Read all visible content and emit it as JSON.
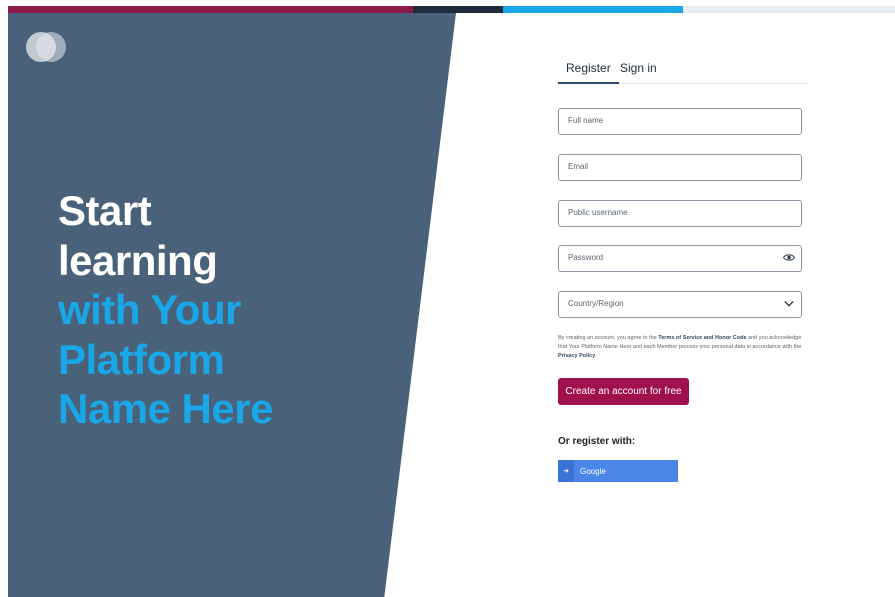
{
  "colors": {
    "panel": "#4a6279",
    "accent_blue": "#1aa7e8",
    "brand_magenta": "#a0104e",
    "tab_underline": "#2e4a66",
    "google_blue": "#4a86e8",
    "topbar_segments": [
      "#8b1a4a",
      "#8b1a4a",
      "#1c2c3a",
      "#1aa7e8",
      "#e6edf2"
    ]
  },
  "hero": {
    "line1": "Start",
    "line2": "learning",
    "line3": "with Your",
    "line4": "Platform",
    "line5": "Name Here"
  },
  "tabs": {
    "register": "Register",
    "signin": "Sign in"
  },
  "form": {
    "fullname_placeholder": "Full name",
    "email_placeholder": "Email",
    "username_placeholder": "Public username",
    "password_placeholder": "Password",
    "country_placeholder": "Country/Region",
    "password_toggle_icon": "eye-icon",
    "country_dropdown_icon": "chevron-down-icon"
  },
  "terms": {
    "before": "By creating an account, you agree to the ",
    "link1": "Terms of Service and Honor Code",
    "middle": " and you acknowledge that Your Platform Name Here and each Member process your personal data in accordance with the ",
    "link2": "Privacy Policy",
    "after": "."
  },
  "create_button": "Create an account for free",
  "or_register_with": "Or register with:",
  "google_button": "Google",
  "google_icon": "sign-in-icon"
}
